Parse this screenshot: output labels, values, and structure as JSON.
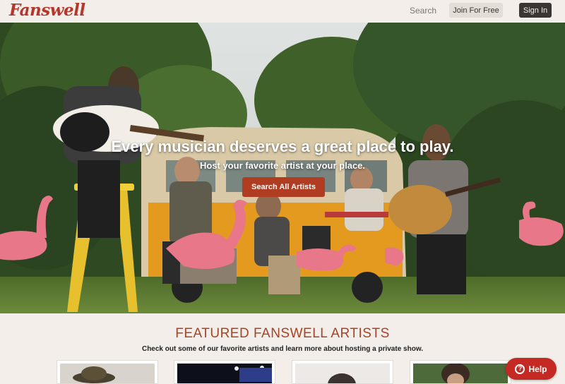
{
  "header": {
    "logo": "Fanswell",
    "search_label": "Search",
    "join_label": "Join For Free",
    "signin_label": "Sign In"
  },
  "hero": {
    "title": "Every musician deserves a great place to play.",
    "subtitle": "Host your favorite artist at your place.",
    "cta_label": "Search All Artists"
  },
  "featured": {
    "title": "FEATURED FANSWELL ARTISTS",
    "subtitle": "Check out some of our favorite artists and learn more about hosting a private show.",
    "cards": [
      {
        "name": "artist-card-1"
      },
      {
        "name": "artist-card-2"
      },
      {
        "name": "artist-card-3"
      },
      {
        "name": "artist-card-4"
      }
    ]
  },
  "help": {
    "label": "Help",
    "icon": "question-icon"
  },
  "colors": {
    "brand": "#b5372c",
    "cta": "#b03d22",
    "background": "#f3eee9",
    "help": "#c42a23"
  }
}
